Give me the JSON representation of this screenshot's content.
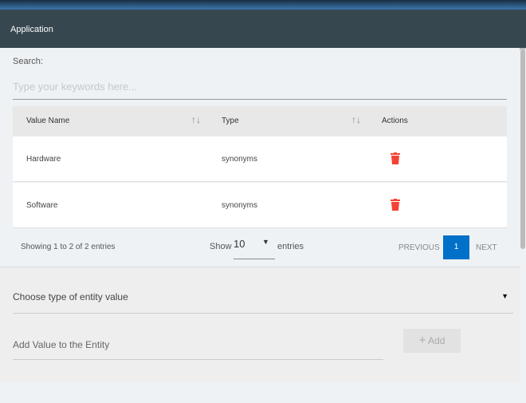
{
  "header": {
    "title": "Application"
  },
  "search": {
    "label": "Search:",
    "placeholder": "Type your keywords here..."
  },
  "table": {
    "columns": [
      "Value Name",
      "Type",
      "Actions"
    ],
    "rows": [
      {
        "name": "Hardware",
        "type": "synonyms"
      },
      {
        "name": "Software",
        "type": "synonyms"
      }
    ]
  },
  "footer": {
    "info": "Showing 1 to 2 of 2 entries",
    "show": "Show",
    "page_size": "10",
    "entries": "entries",
    "previous": "PREVIOUS",
    "page": "1",
    "next": "NEXT"
  },
  "form": {
    "select_placeholder": "Choose type of entity value",
    "value_placeholder": "Add Value to the Entity",
    "add_label": "Add",
    "add_icon": "+"
  },
  "colors": {
    "header": "#37474f",
    "accent": "#0070c9",
    "delete": "#f44336"
  }
}
